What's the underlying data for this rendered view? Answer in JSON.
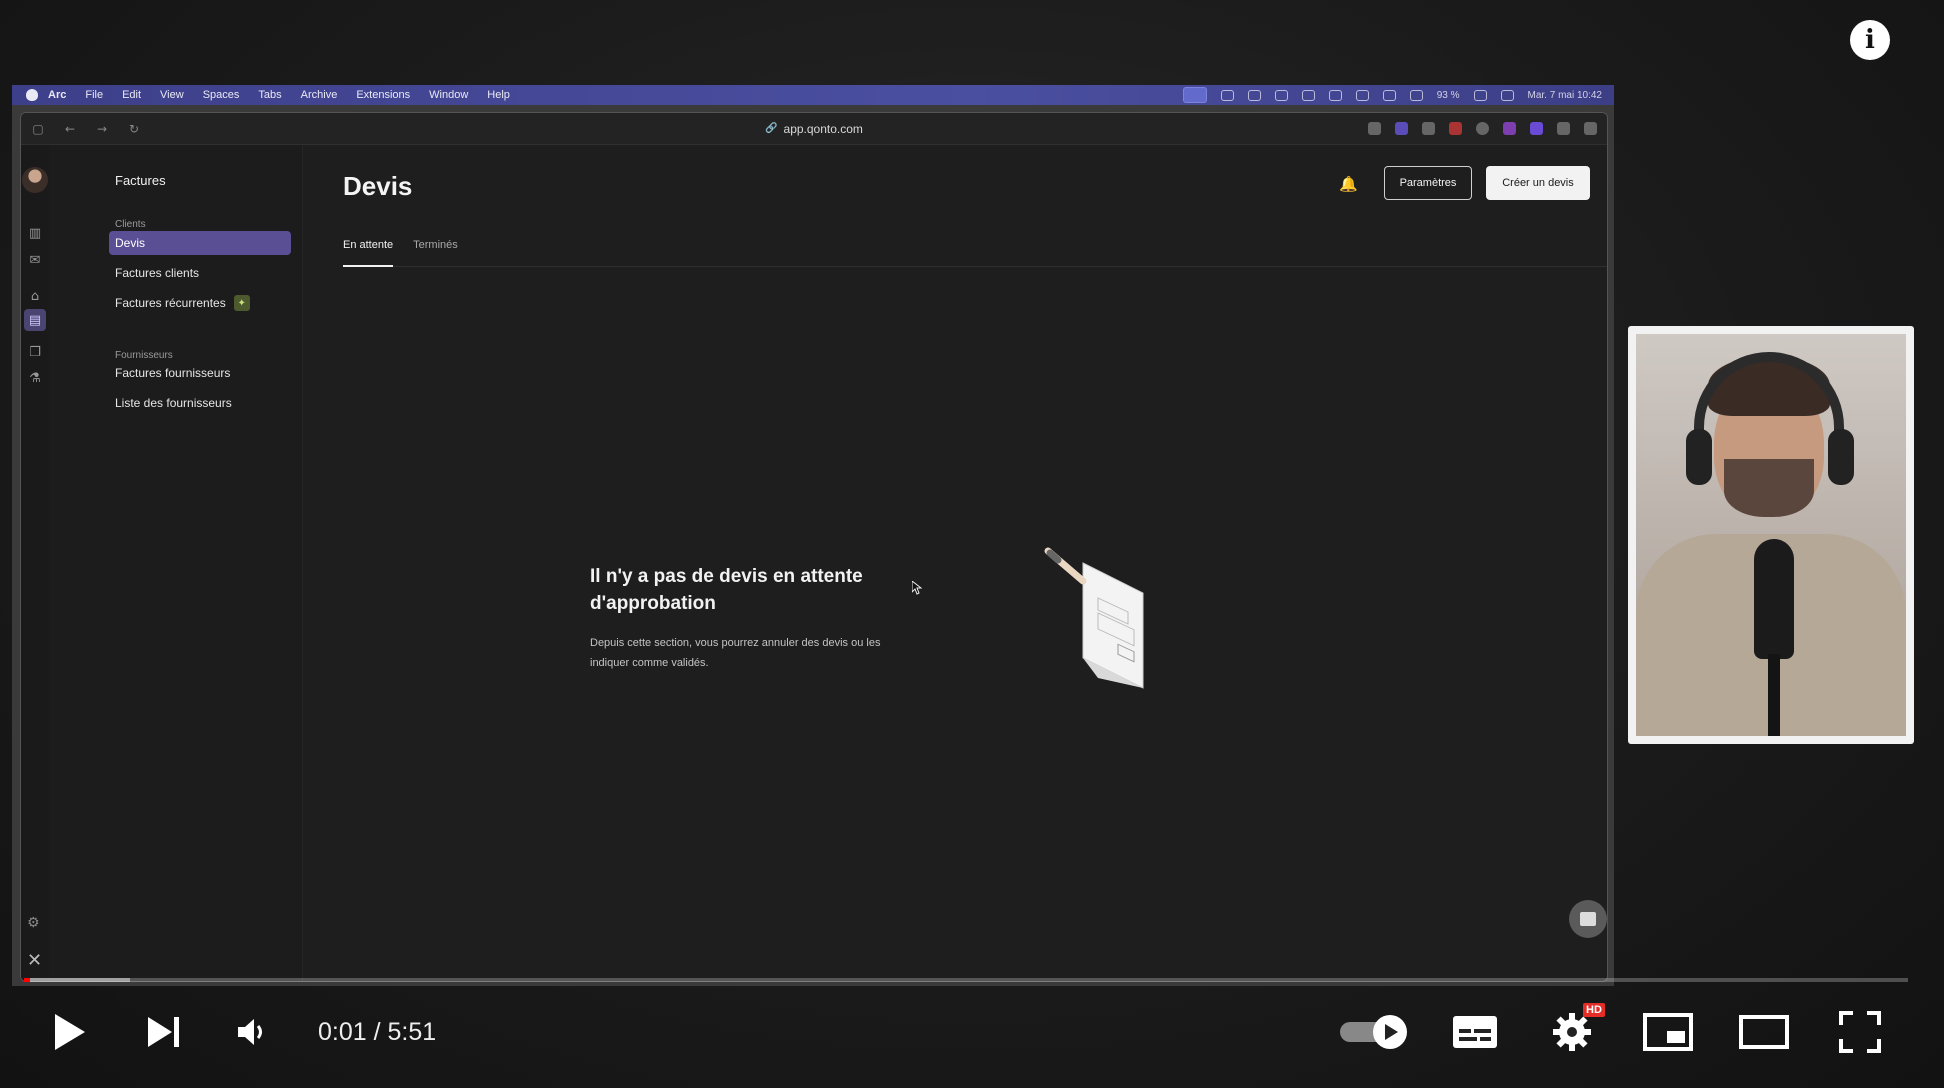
{
  "player": {
    "current_time": "0:01",
    "separator": "/",
    "duration": "5:51",
    "hd_badge": "HD",
    "progress_fraction": 0.003,
    "buffered_fraction": 0.056
  },
  "menubar": {
    "app": "Arc",
    "items": [
      "File",
      "Edit",
      "View",
      "Spaces",
      "Tabs",
      "Archive",
      "Extensions",
      "Window",
      "Help"
    ],
    "battery": "93 %",
    "datetime": "Mar. 7 mai 10:42"
  },
  "browser": {
    "url": "app.qonto.com"
  },
  "sidebar": {
    "title": "Factures",
    "section_clients": "Clients",
    "items_clients": [
      "Devis",
      "Factures clients",
      "Factures récurrentes"
    ],
    "section_suppliers": "Fournisseurs",
    "items_suppliers": [
      "Factures fournisseurs",
      "Liste des fournisseurs"
    ]
  },
  "main": {
    "title": "Devis",
    "settings_button": "Paramètres",
    "create_button": "Créer un devis",
    "tabs": [
      "En attente",
      "Terminés"
    ],
    "empty_title": "Il n'y a pas de devis en attente d'approbation",
    "empty_description": "Depuis cette section, vous pourrez annuler des devis ou les indiquer comme validés."
  },
  "colors": {
    "accent": "#5a4f95",
    "progress": "#ff0000",
    "menubar": "#4b4fa0"
  }
}
